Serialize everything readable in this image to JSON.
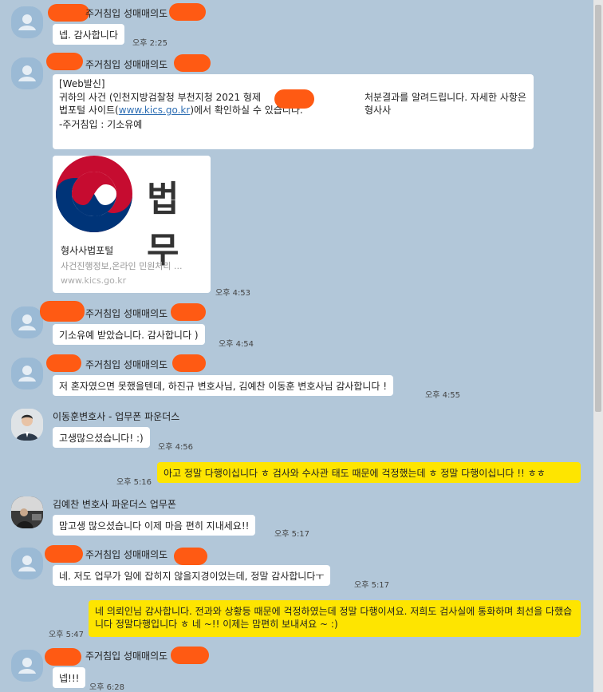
{
  "messages": [
    {
      "sender": "주거침입 성매매의도",
      "text": "넵. 감사합니다",
      "time": "오후 2:25"
    },
    {
      "sender": "주거침입 성매매의도",
      "lines": [
        "[Web발신]",
        "귀하의 사건 (인천지방검찰청 부천지청 2021 형제",
        "처분결과를 알려드립니다. 자세한 사항은 형사사",
        "법포털 사이트(",
        "www.kics.go.kr",
        ")에서 확인하실 수 있습니다.",
        "-주거침입 : 기소유예"
      ],
      "card": {
        "logo_text": "법무",
        "title": "형사사법포털",
        "desc": "사건진행정보,온라인 민원처리 ...",
        "url": "www.kics.go.kr"
      },
      "time": "오후 4:53"
    },
    {
      "sender": "주거침입 성매매의도",
      "text": "기소유예 받았습니다. 감사합니다 )",
      "time": "오후 4:54"
    },
    {
      "sender": "주거침입 성매매의도",
      "text": "저 혼자였으면 못했을텐데, 하진규 변호사님,  김예찬 이동훈 변호사님 감사합니다 !",
      "time": "오후 4:55"
    },
    {
      "sender": "이동훈변호사 - 업무폰 파운더스",
      "text": "고생많으셨습니다! :)",
      "time": "오후 4:56"
    },
    {
      "text": "아고 정말 다행이십니다 ㅎ 검사와 수사관 태도 때문에 걱정했는데 ㅎ 정말 다행이십니다 !! ㅎㅎ",
      "time": "오후 5:16"
    },
    {
      "sender": "김예찬 변호사 파운더스 업무폰",
      "text": "맘고생 많으셨습니다 이제 마음 편히 지내세요!!",
      "time": "오후 5:17"
    },
    {
      "sender": "주거침입 성매매의도",
      "text": "네. 저도 업무가 일에 잡히지 않을지경이었는데, 정말 감사합니다ㅜ",
      "time": "오후 5:17"
    },
    {
      "text": "네 의뢰인님 감사합니다. 전과와 상황등 때문에 걱정하였는데 정말 다행이셔요. 저희도 검사실에 통화하며 최선을 다했습니다 정말다행입니다 ㅎ 네 ~!! 이제는 맘편히 보내셔요 ~ :)",
      "time": "오후 5:47"
    },
    {
      "sender": "주거침입 성매매의도",
      "text": "넵!!!",
      "time": "오후 6:28"
    }
  ],
  "colors": {
    "background": "#b2c7d9",
    "my_bubble": "#fee500",
    "other_bubble": "#ffffff",
    "redaction": "#ff5a13",
    "link": "#2f6fb4"
  }
}
